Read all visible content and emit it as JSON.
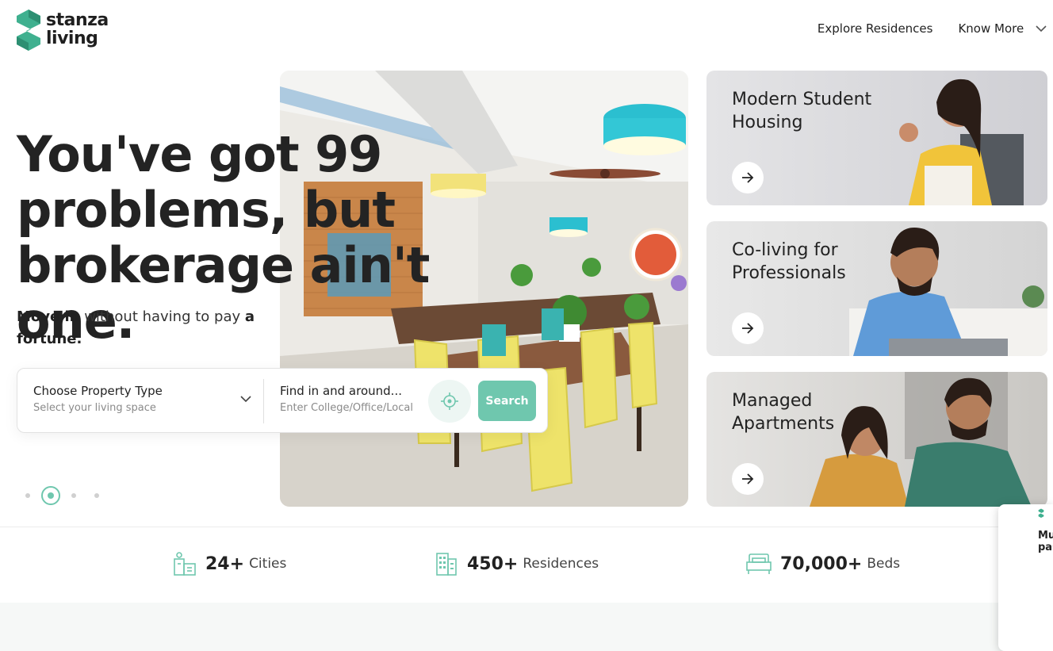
{
  "brand": {
    "name_line1": "stanza",
    "name_line2": "living"
  },
  "nav": {
    "explore": "Explore Residences",
    "know_more": "Know More"
  },
  "hero": {
    "headline": "You've got 99 problems, but brokerage ain't one.",
    "sub_bold1": "Move in",
    "sub_mid": " without having to pay ",
    "sub_bold2": "a fortune."
  },
  "search": {
    "property_title": "Choose Property Type",
    "property_sub": "Select your living space",
    "find_title": "Find in and around...",
    "find_placeholder": "Enter College/Office/Local",
    "button": "Search"
  },
  "carousel": {
    "total": 4,
    "active": 2
  },
  "cards": [
    {
      "title": "Modern Student Housing"
    },
    {
      "title": "Co-living for Professionals"
    },
    {
      "title": "Managed Apartments"
    }
  ],
  "stats": [
    {
      "num": "24+",
      "label": "Cities",
      "icon": "city-icon"
    },
    {
      "num": "450+",
      "label": "Residences",
      "icon": "building-icon"
    },
    {
      "num": "70,000+",
      "label": "Beds",
      "icon": "bed-icon"
    }
  ],
  "side_popup": {
    "text": "Mu Zer pas"
  },
  "colors": {
    "accent": "#6fc7ae",
    "logo_green": "#3fb08f",
    "text_dark": "#232323"
  }
}
